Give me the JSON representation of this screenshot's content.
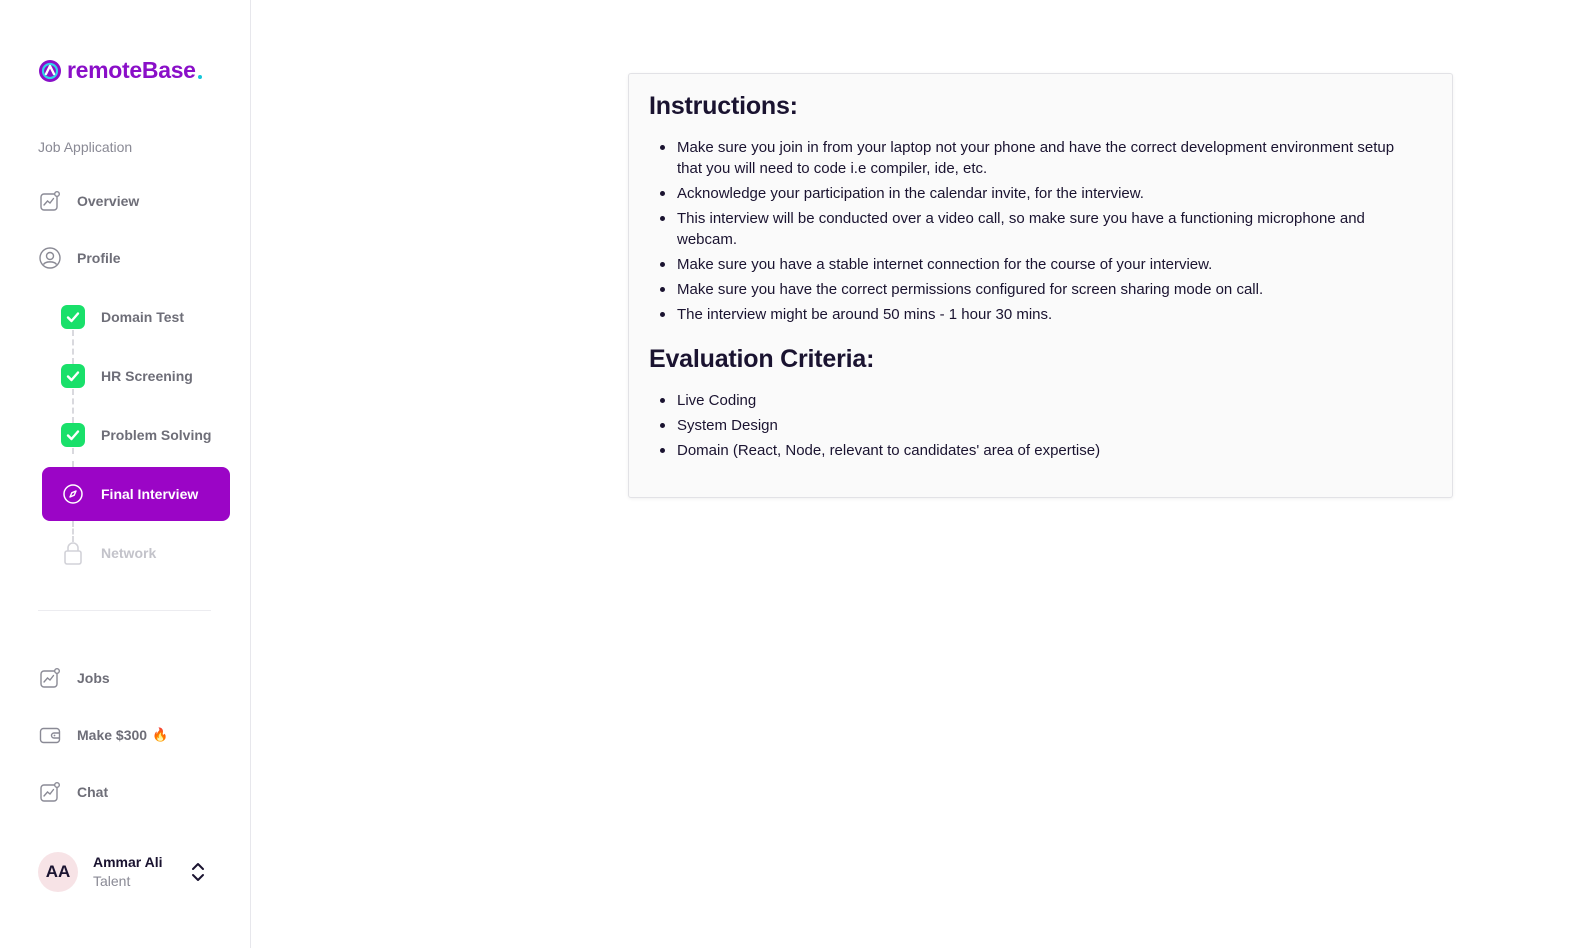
{
  "brand": {
    "name": "remoteBase"
  },
  "sidebar": {
    "section_label": "Job Application",
    "top_items": [
      {
        "label": "Overview",
        "icon": "chart-icon"
      },
      {
        "label": "Profile",
        "icon": "user-circle-icon"
      }
    ],
    "steps": [
      {
        "label": "Domain Test",
        "status": "completed"
      },
      {
        "label": "HR Screening",
        "status": "completed"
      },
      {
        "label": "Problem Solving",
        "status": "completed"
      },
      {
        "label": "Final Interview",
        "status": "active"
      },
      {
        "label": "Network",
        "status": "locked"
      }
    ],
    "bottom_items": [
      {
        "label": "Jobs",
        "icon": "chart-icon"
      },
      {
        "label": "Make $300",
        "icon": "wallet-icon",
        "emoji": "🔥"
      },
      {
        "label": "Chat",
        "icon": "chart-icon"
      }
    ],
    "user": {
      "initials": "AA",
      "name": "Ammar Ali",
      "role": "Talent"
    }
  },
  "content": {
    "instructions_title": "Instructions:",
    "instructions": [
      "Make sure you join in from your laptop not your phone and have the correct development environment setup that you will need to code i.e compiler, ide, etc.",
      "Acknowledge your participation in the calendar invite, for the interview.",
      "This interview will be conducted over a video call, so make sure you have a functioning microphone and webcam.",
      "Make sure you have a stable internet connection for the course of your interview.",
      "Make sure you have the correct permissions configured for screen sharing mode on call.",
      "The interview might be around 50 mins - 1 hour 30 mins."
    ],
    "criteria_title": "Evaluation Criteria:",
    "criteria": [
      "Live Coding",
      "System Design",
      "Domain (React, Node, relevant to candidates' area of expertise)"
    ]
  },
  "colors": {
    "brand_purple": "#8a0fc8",
    "active_step": "#9b05c6",
    "check_green": "#19e06a",
    "logo_dot": "#14c7d9"
  }
}
